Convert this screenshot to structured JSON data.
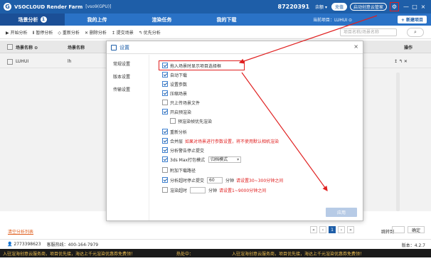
{
  "titlebar": {
    "logo": "G",
    "title": "VSOCLOUD Render Farm",
    "version": "[vso9(GPU)]",
    "user_id": "87220391",
    "balance": "余额",
    "recharge": "充值",
    "launch": "启动创意云管家",
    "gear_icon": "gear-icon",
    "min": "—",
    "max": "□",
    "close": "×"
  },
  "nav": {
    "tabs": [
      {
        "label": "场景分析",
        "badge": "1"
      },
      {
        "label": "我的上传"
      },
      {
        "label": "渲染任务"
      },
      {
        "label": "我的下载"
      }
    ],
    "current_project": "当前项目：LUHUI ⊙",
    "new_project": "+ 新建项目"
  },
  "toolbar": {
    "items": [
      "▶ 开始分析",
      "Ⅱ 暂停分析",
      "◇ 重新分析",
      "✕ 删除分析",
      "↥ 提交场景",
      "↰ 优先分析"
    ],
    "search_placeholder": "项目名称/场景名称"
  },
  "table": {
    "headers": [
      "场景名称 ⊙",
      "场景名称",
      "操作"
    ],
    "rows": [
      {
        "name": "LUHUI",
        "col2": "lh",
        "actions": "↥  ↰  ✕"
      }
    ]
  },
  "dialog": {
    "title": "设置",
    "close": "×",
    "sidebar": [
      "常规设置",
      "版本设置",
      "传输设置"
    ],
    "options": [
      {
        "label": "拖入场景时显示项目选择框",
        "checked": true
      },
      {
        "label": "自动下载",
        "checked": true
      },
      {
        "label": "设置参数",
        "checked": true
      },
      {
        "label": "压缩场景",
        "checked": true
      },
      {
        "label": "只上传场景文件",
        "checked": false
      },
      {
        "label": "开启预渲染",
        "checked": true
      },
      {
        "label": "预渲染帧优先渲染",
        "checked": false
      },
      {
        "label": "重新分析",
        "checked": true
      },
      {
        "label": "合并层",
        "checked": true,
        "note": "如果对场景进行参数设置，将不使用默认相机渲染"
      },
      {
        "label": "分析警告停止提交",
        "checked": true
      },
      {
        "label": "3ds Max打包模式",
        "checked": true,
        "select": "归档模式"
      },
      {
        "label": "附加下载路径",
        "checked": false
      },
      {
        "label": "分析超时停止提交",
        "checked": true,
        "value": "60",
        "unit": "分钟",
        "note": "请设置30~300分钟之间"
      },
      {
        "label": "渲染超时",
        "checked": false,
        "unit": "分钟",
        "note": "请设置1~9000分钟之间"
      }
    ],
    "apply": "应用"
  },
  "pager": {
    "footer_link": "清空分析列表",
    "buttons": [
      "«",
      "‹",
      "1",
      "›",
      "»"
    ],
    "goto_label": "跳转到",
    "confirm": "确定"
  },
  "status": {
    "user": "2773398623",
    "phone": "客服热线：400-164-7979",
    "version": "版本：4.2.7"
  },
  "marquee": {
    "text": "入驻渲海创意云服务商，项目优先接，海达上千元渲染优惠券免费领！",
    "prefix": "热处中："
  },
  "colors": {
    "brand": "#1e5ea8",
    "accent": "#e02020"
  }
}
